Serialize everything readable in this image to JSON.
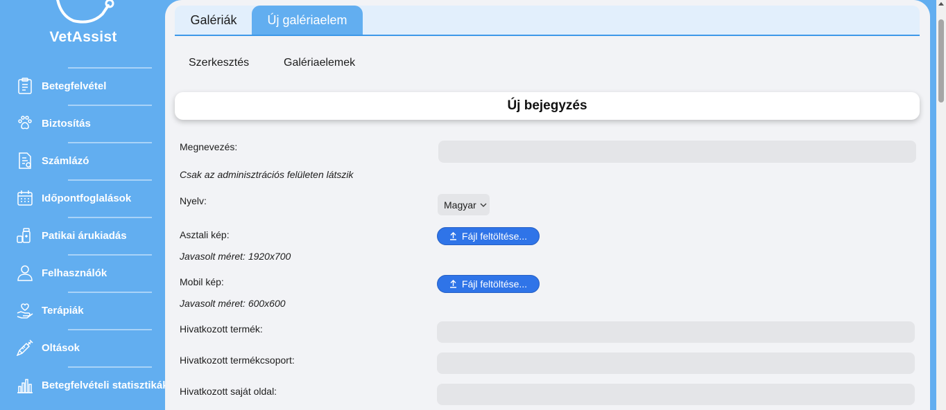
{
  "brand": {
    "name": "VetAssist"
  },
  "sidebar": {
    "items": [
      {
        "label": "Betegfelvétel",
        "icon": "clipboard-icon"
      },
      {
        "label": "Biztosítás",
        "icon": "paw-icon"
      },
      {
        "label": "Számlázó",
        "icon": "invoice-icon"
      },
      {
        "label": "Időpontfoglalások",
        "icon": "calendar-icon"
      },
      {
        "label": "Patikai árukiadás",
        "icon": "medicine-icon"
      },
      {
        "label": "Felhasználók",
        "icon": "user-icon"
      },
      {
        "label": "Terápiák",
        "icon": "hand-heart-icon"
      },
      {
        "label": "Oltások",
        "icon": "syringe-icon"
      },
      {
        "label": "Betegfelvételi statisztikák",
        "icon": "bar-chart-icon"
      }
    ]
  },
  "tabs": {
    "galleries": "Galériák",
    "new_item": "Új galériaelem"
  },
  "subtabs": {
    "edit": "Szerkesztés",
    "items": "Galériaelemek"
  },
  "form": {
    "title": "Új bejegyzés",
    "name_label": "Megnevezés:",
    "name_value": "",
    "admin_hint": "Csak az adminisztrációs felületen látszik",
    "language_label": "Nyelv:",
    "language_value": "Magyar",
    "desktop_label": "Asztali kép:",
    "desktop_hint": "Javasolt méret: 1920x700",
    "mobile_label": "Mobil kép:",
    "mobile_hint": "Javasolt méret: 600x600",
    "upload_label": "Fájl feltöltése...",
    "product_label": "Hivatkozott termék:",
    "product_value": "",
    "group_label": "Hivatkozott termékcsoport:",
    "group_value": "",
    "page_label": "Hivatkozott saját oldal:",
    "page_value": ""
  },
  "colors": {
    "sidebar": "#62aef0",
    "primary_button": "#2f74e8",
    "panel": "#f2f3f6"
  }
}
